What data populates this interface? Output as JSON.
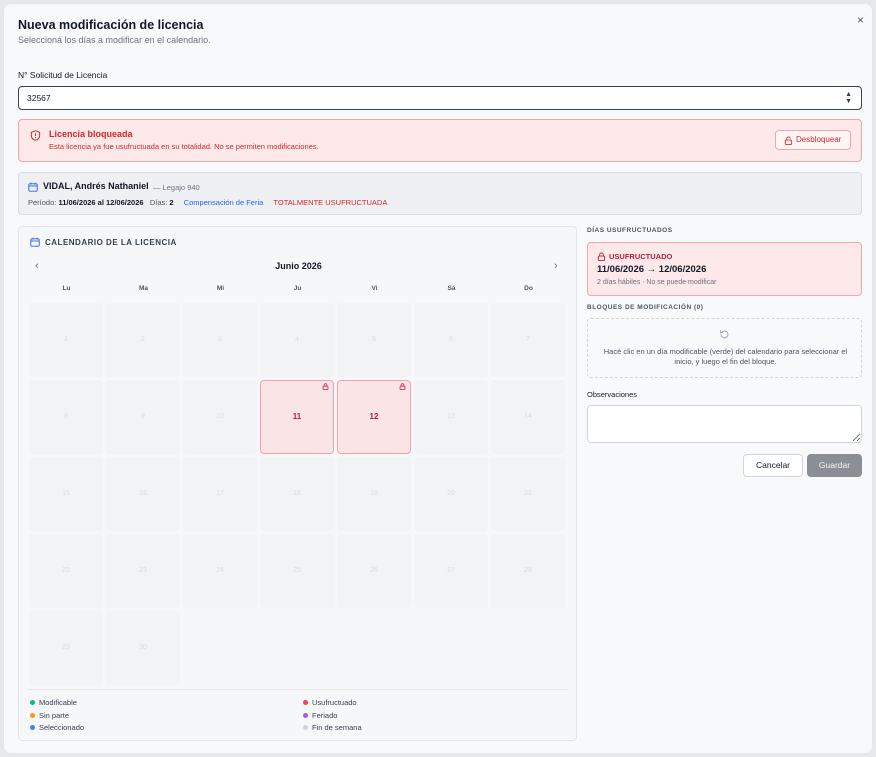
{
  "modal": {
    "title": "Nueva modificación de licencia",
    "subtitle": "Seleccioná los días a modificar en el calendario.",
    "close_icon": "×"
  },
  "request": {
    "label": "N° Solicitud de Licencia",
    "value": "32567"
  },
  "alert": {
    "title": "Licencia bloqueada",
    "description": "Esta licencia ya fue usufructuada en su totalidad. No se permiten modificaciones.",
    "unlock_label": "Desbloquear"
  },
  "person": {
    "name": "VIDAL, Andrés Nathaniel",
    "legajo": "— Legajo 940",
    "period_label": "Período:",
    "period_value": "11/06/2026 al 12/06/2026",
    "days_label": "Días:",
    "days_value": "2",
    "type": "Compensación de Feria",
    "status": "TOTALMENTE USUFRUCTUADA"
  },
  "calendar": {
    "header": "CALENDARIO DE LA LICENCIA",
    "prev": "‹",
    "next": "›",
    "month": "Junio 2026",
    "weekdays": [
      "Lu",
      "Ma",
      "Mi",
      "Ju",
      "Vi",
      "Sá",
      "Do"
    ],
    "weeks": [
      [
        "1",
        "2",
        "3",
        "4",
        "5",
        "6",
        "7"
      ],
      [
        "8",
        "9",
        "10",
        "11",
        "12",
        "13",
        "14"
      ],
      [
        "15",
        "16",
        "17",
        "18",
        "19",
        "20",
        "21"
      ],
      [
        "22",
        "23",
        "24",
        "25",
        "26",
        "27",
        "28"
      ],
      [
        "29",
        "30",
        "",
        "",
        "",
        "",
        ""
      ]
    ],
    "used_days": [
      "11",
      "12"
    ],
    "legend": [
      {
        "label": "Modificable",
        "color": "#10b981"
      },
      {
        "label": "Usufructuado",
        "color": "#f43f5e"
      },
      {
        "label": "Sin parte",
        "color": "#f59e0b"
      },
      {
        "label": "Feriado",
        "color": "#a855f7"
      },
      {
        "label": "Seleccionado",
        "color": "#3b82f6"
      },
      {
        "label": "Fin de semana",
        "color": "#d1d5db"
      }
    ]
  },
  "side": {
    "used_title": "DÍAS USUFRUCTUADOS",
    "used_tag": "USUFRUCTUADO",
    "used_range": "11/06/2026 → 12/06/2026",
    "used_note": "2 días hábiles · No se puede modificar",
    "blocks_title": "BLOQUES DE MODIFICACIÓN (0)",
    "blocks_hint": "Hacé clic en un día modificable (verde) del calendario para seleccionar el inicio, y luego el fin del bloque.",
    "obs_label": "Observaciones",
    "obs_value": "",
    "cancel_label": "Cancelar",
    "save_label": "Guardar"
  },
  "colors": {
    "danger": "#dc2626",
    "link": "#2563eb",
    "used_bg": "#fbe4e6",
    "save_disabled": "#8a8f96"
  }
}
